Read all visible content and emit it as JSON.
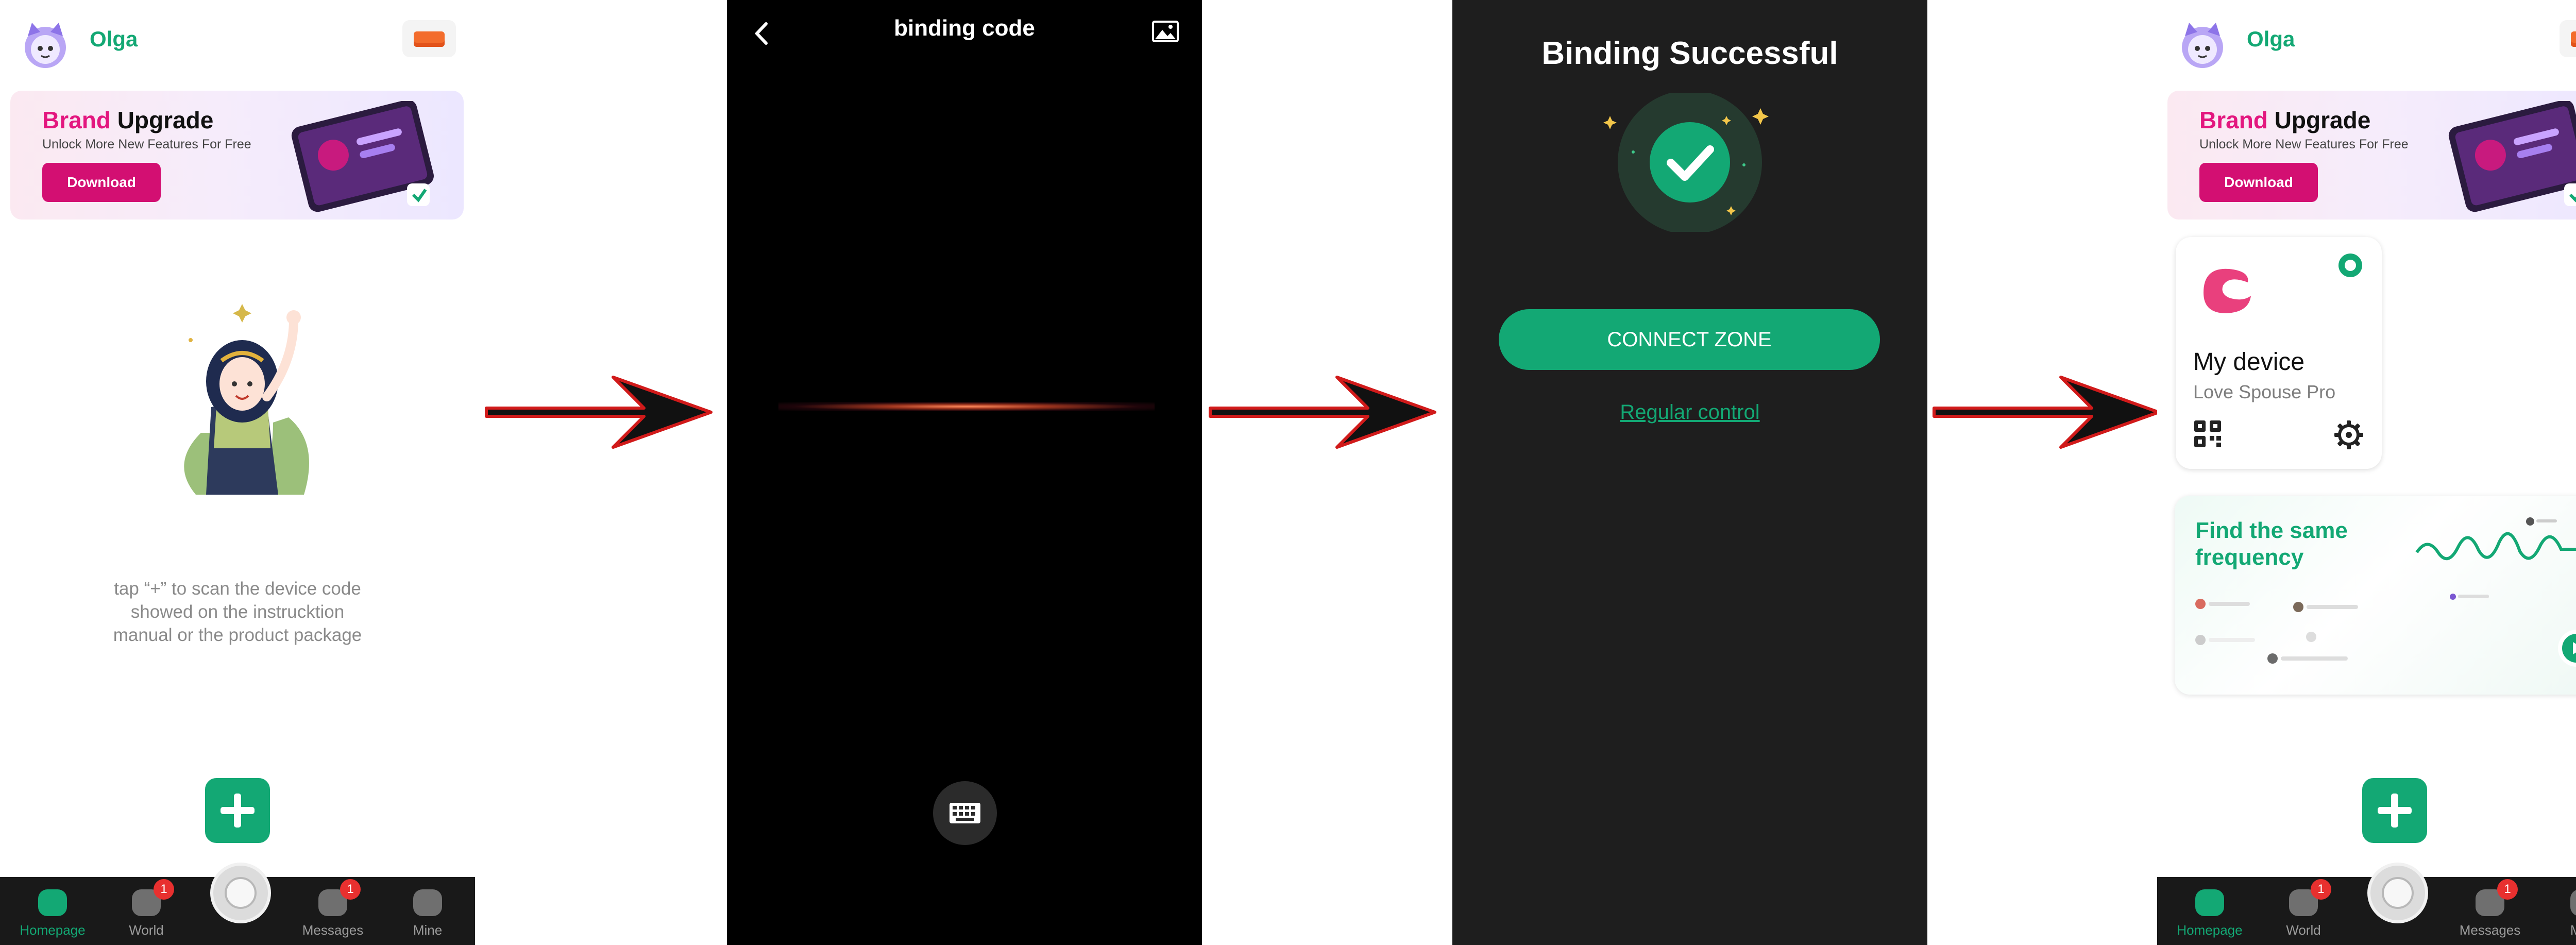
{
  "colors": {
    "accent_green": "#13a874",
    "brand_pink": "#d30f72",
    "badge_red": "#e8302f",
    "dark_bg": "#1e1e1e",
    "arrow_red": "#d11a1a"
  },
  "home": {
    "username": "Olga",
    "banner": {
      "title_word1": "Brand",
      "title_word2": "Upgrade",
      "subtitle": "Unlock More New Features For Free",
      "button": "Download"
    },
    "empty_message": "tap “+” to scan the device code showed on the instrucktion manual or the product package",
    "add_icon": "plus-icon"
  },
  "tabbar": {
    "tabs": [
      {
        "label": "Homepage",
        "icon": "home-icon",
        "active": true
      },
      {
        "label": "World",
        "icon": "planet-icon",
        "badge": "1"
      },
      {
        "label": "Messages",
        "icon": "chat-icon",
        "badge": "1"
      },
      {
        "label": "Mine",
        "icon": "profile-icon"
      }
    ]
  },
  "scan": {
    "title": "binding code",
    "back_icon": "chevron-left-icon",
    "gallery_icon": "image-icon",
    "keyboard_icon": "keyboard-icon"
  },
  "success": {
    "title": "Binding Successful",
    "connect_button": "CONNECT ZONE",
    "regular_link": "Regular control"
  },
  "device": {
    "name": "My device",
    "model": "Love Spouse Pro",
    "qr_icon": "qr-code-icon",
    "settings_icon": "gear-icon"
  },
  "freq_card": {
    "title": "Find the same frequency"
  }
}
